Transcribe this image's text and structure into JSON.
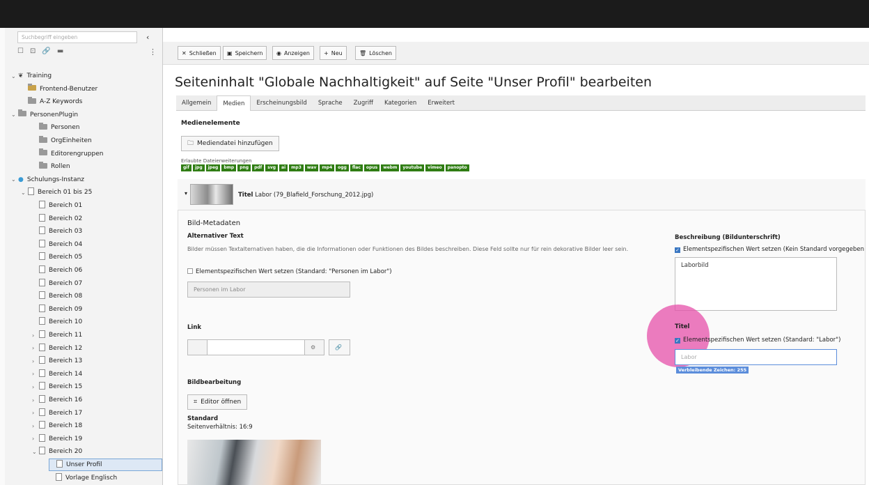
{
  "tree": {
    "search_placeholder": "Suchbegriff eingeben",
    "items": [
      {
        "label": "Training"
      },
      {
        "label": "Frontend-Benutzer"
      },
      {
        "label": "A-Z Keywords"
      },
      {
        "label": "PersonenPlugin"
      },
      {
        "label": "Personen"
      },
      {
        "label": "OrgEinheiten"
      },
      {
        "label": "Editorengruppen"
      },
      {
        "label": "Rollen"
      },
      {
        "label": "Schulungs-Instanz"
      },
      {
        "label": "Bereich 01 bis 25"
      },
      {
        "label": "Bereich 01"
      },
      {
        "label": "Bereich 02"
      },
      {
        "label": "Bereich 03"
      },
      {
        "label": "Bereich 04"
      },
      {
        "label": "Bereich 05"
      },
      {
        "label": "Bereich 06"
      },
      {
        "label": "Bereich 07"
      },
      {
        "label": "Bereich 08"
      },
      {
        "label": "Bereich 09"
      },
      {
        "label": "Bereich 10"
      },
      {
        "label": "Bereich 11"
      },
      {
        "label": "Bereich 12"
      },
      {
        "label": "Bereich 13"
      },
      {
        "label": "Bereich 14"
      },
      {
        "label": "Bereich 15"
      },
      {
        "label": "Bereich 16"
      },
      {
        "label": "Bereich 17"
      },
      {
        "label": "Bereich 18"
      },
      {
        "label": "Bereich 19"
      },
      {
        "label": "Bereich 20"
      },
      {
        "label": "Unser Profil"
      },
      {
        "label": "Vorlage Englisch"
      }
    ]
  },
  "toolbar": {
    "close": "Schließen",
    "save": "Speichern",
    "view": "Anzeigen",
    "new": "Neu",
    "delete": "Löschen"
  },
  "page_title": "Seiteninhalt \"Globale Nachhaltigkeit\" auf Seite \"Unser Profil\" bearbeiten",
  "tabs": [
    "Allgemein",
    "Medien",
    "Erscheinungsbild",
    "Sprache",
    "Zugriff",
    "Kategorien",
    "Erweitert"
  ],
  "media": {
    "section": "Medienelemente",
    "add_button": "Mediendatei hinzufügen",
    "allowed_label": "Erlaubte Dateierweiterungen",
    "extensions": [
      "gif",
      "jpg",
      "jpeg",
      "bmp",
      "png",
      "pdf",
      "svg",
      "ai",
      "mp3",
      "wav",
      "mp4",
      "ogg",
      "flac",
      "opus",
      "webm",
      "youtube",
      "vimeo",
      "panopto"
    ],
    "item_title_label": "Titel",
    "item_title_value": "Labor (79_Blafield_Forschung_2012.jpg)",
    "metadata_heading": "Bild-Metadaten",
    "alt_label": "Alternativer Text",
    "alt_desc": "Bilder müssen Textalternativen haben, die die Informationen oder Funktionen des Bildes beschreiben. Diese Feld sollte nur für rein dekorative Bilder leer sein.",
    "alt_checkbox": "Elementspezifischen Wert setzen (Standard: \"Personen im Labor\")",
    "alt_value": "Personen im Labor",
    "link_label": "Link",
    "edit_label": "Bildbearbeitung",
    "editor_button": "Editor öffnen",
    "standard_label": "Standard",
    "ratio_label": "Seitenverhältnis: 16:9",
    "desc_label": "Beschreibung (Bildunterschrift)",
    "desc_checkbox": "Elementspezifischen Wert setzen (Kein Standard vorgegeben",
    "desc_value": "Laborbild",
    "title_label": "Titel",
    "title_checkbox": "Elementspezifischen Wert setzen (Standard: \"Labor\")",
    "title_value": "Labor",
    "remaining": "Verbleibende Zeichen: 255"
  }
}
